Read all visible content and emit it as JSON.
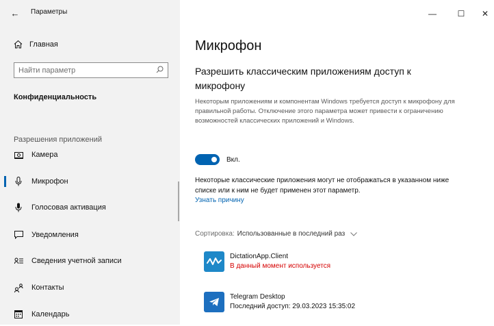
{
  "window": {
    "title": "Параметры",
    "minimize": "—",
    "maximize": "☐",
    "close": "✕"
  },
  "sidebar": {
    "home_label": "Главная",
    "search_placeholder": "Найти параметр",
    "section_title": "Конфиденциальность",
    "group_label": "Разрешения приложений",
    "items": [
      {
        "label": "Камера",
        "icon": "camera-icon"
      },
      {
        "label": "Микрофон",
        "icon": "microphone-icon"
      },
      {
        "label": "Голосовая активация",
        "icon": "voice-activation-icon"
      },
      {
        "label": "Уведомления",
        "icon": "notifications-icon"
      },
      {
        "label": "Сведения учетной записи",
        "icon": "account-info-icon"
      },
      {
        "label": "Контакты",
        "icon": "contacts-icon"
      },
      {
        "label": "Календарь",
        "icon": "calendar-icon"
      }
    ],
    "active_index": 1
  },
  "main": {
    "page_title": "Микрофон",
    "subheading": "Разрешить классическим приложениям доступ к микрофону",
    "description": "Некоторым приложениям и компонентам Windows требуется доступ к микрофону для правильной работы. Отключение этого параметра может привести к ограничению возможностей классических приложений и Windows.",
    "toggle": {
      "state": "on",
      "label": "Вкл."
    },
    "note": "Некоторые классические приложения могут не отображаться в указанном ниже списке или к ним не будет применен этот параметр.",
    "learn_link": "Узнать причину",
    "sort_label": "Сортировка:",
    "sort_value": "Использованные в последний раз",
    "apps": [
      {
        "name": "DictationApp.Client",
        "status": "В данный момент используется",
        "icon": "dictation-app-icon"
      },
      {
        "name": "Telegram Desktop",
        "status": "Последний доступ: 29.03.2023 15:35:02",
        "icon": "telegram-icon"
      }
    ]
  },
  "colors": {
    "accent": "#0063b1",
    "sidebar_bg": "#f2f2f2",
    "in_use_red": "#d50000",
    "dictation_icon_bg": "#1e88c8",
    "telegram_icon_bg": "#1d6fbf"
  }
}
